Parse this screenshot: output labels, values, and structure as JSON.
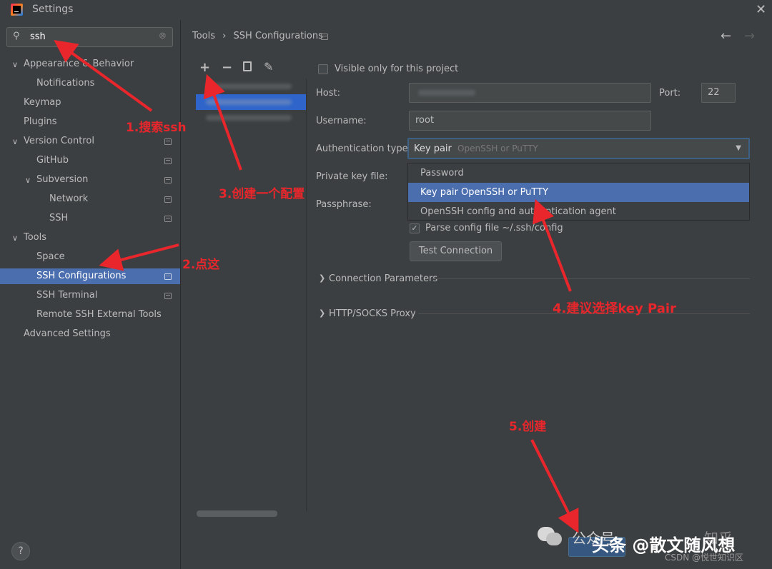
{
  "window": {
    "title": "Settings"
  },
  "search": {
    "value": "ssh"
  },
  "sidebar": {
    "items": [
      {
        "label": "Appearance & Behavior"
      },
      {
        "label": "Notifications"
      },
      {
        "label": "Keymap"
      },
      {
        "label": "Plugins"
      },
      {
        "label": "Version Control"
      },
      {
        "label": "GitHub"
      },
      {
        "label": "Subversion"
      },
      {
        "label": "Network"
      },
      {
        "label": "SSH"
      },
      {
        "label": "Tools"
      },
      {
        "label": "Space"
      },
      {
        "label": "SSH Configurations"
      },
      {
        "label": "SSH Terminal"
      },
      {
        "label": "Remote SSH External Tools"
      },
      {
        "label": "Advanced Settings"
      }
    ]
  },
  "breadcrumb": {
    "parent": "Tools",
    "separator": "›",
    "current": "SSH Configurations"
  },
  "form": {
    "visible_only": "Visible only for this project",
    "host_label": "Host:",
    "port_label": "Port:",
    "port_value": "22",
    "username_label": "Username:",
    "username_value": "root",
    "auth_label": "Authentication type:",
    "auth_value_main": "Key pair",
    "auth_value_sub": "OpenSSH or PuTTY",
    "private_key_label": "Private key file:",
    "passphrase_label": "Passphrase:",
    "parse_config": "Parse config file ~/.ssh/config",
    "test_connection": "Test Connection",
    "connection_params": "Connection Parameters",
    "proxy": "HTTP/SOCKS Proxy"
  },
  "dropdown": {
    "options": [
      "Password",
      "Key pair OpenSSH or PuTTY",
      "OpenSSH config and authentication agent"
    ]
  },
  "annotations": {
    "a1": "1.搜索ssh",
    "a2": "2.点这",
    "a3": "3.创建一个配置",
    "a4": "4.建议选择key Pair",
    "a5": "5.创建"
  },
  "watermark": {
    "main": "头条 @散文随风想",
    "csdn": "CSDN @悦世知识区",
    "zhihu": "知乎",
    "gzh": "公众号"
  },
  "colors": {
    "accent": "#4b6eaf",
    "annotation": "#e8262b",
    "background": "#3c3f41"
  }
}
